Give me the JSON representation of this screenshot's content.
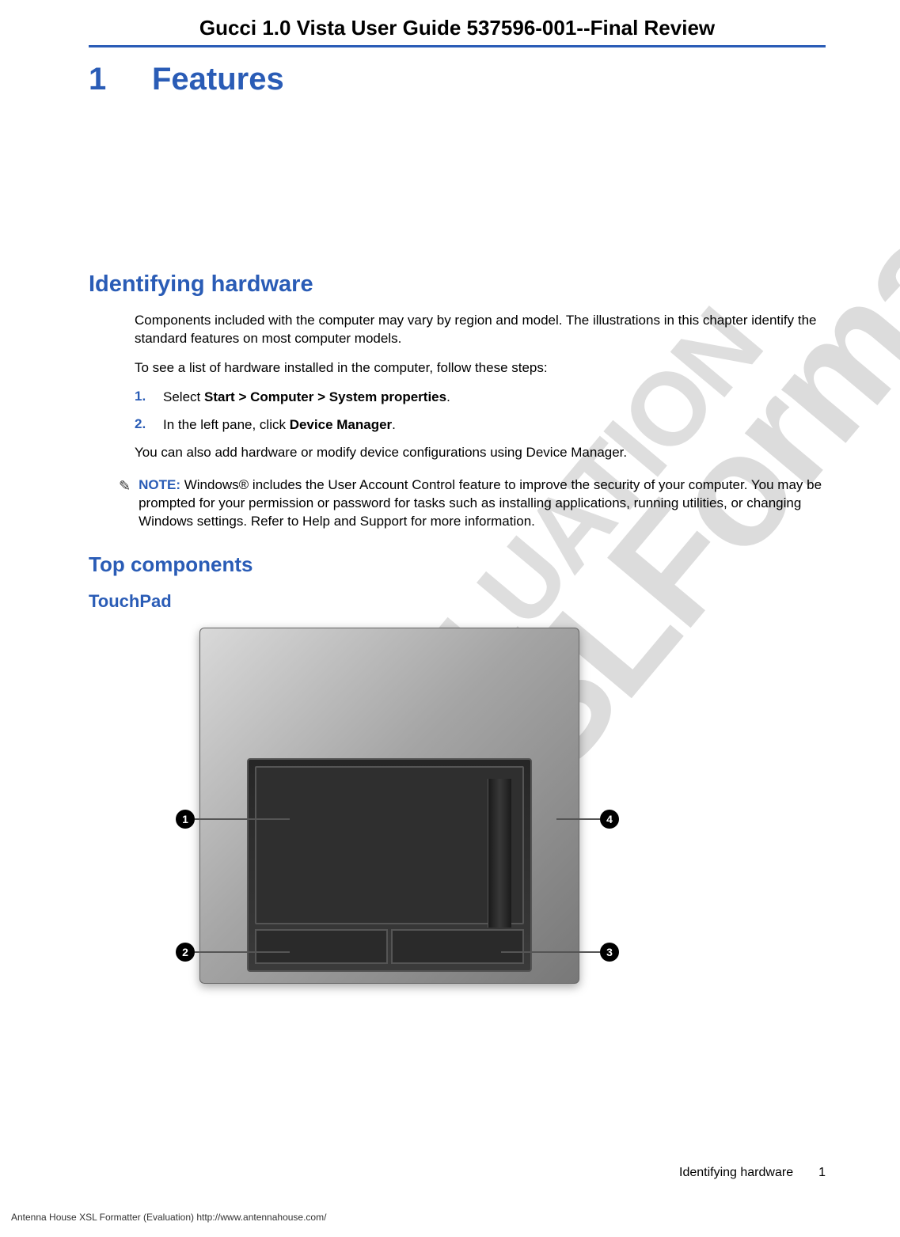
{
  "watermarks": {
    "main": "XSLFormatter",
    "sub": "EVALUATION"
  },
  "header": {
    "title": "Gucci 1.0 Vista User Guide 537596-001--Final Review"
  },
  "chapter": {
    "number": "1",
    "title": "Features"
  },
  "section1": {
    "title": "Identifying hardware",
    "para1": "Components included with the computer may vary by region and model. The illustrations in this chapter identify the standard features on most computer models.",
    "para2": "To see a list of hardware installed in the computer, follow these steps:",
    "steps": [
      {
        "num": "1.",
        "pre": "Select ",
        "bold": "Start > Computer > System properties",
        "post": "."
      },
      {
        "num": "2.",
        "pre": "In the left pane, click ",
        "bold": "Device Manager",
        "post": "."
      }
    ],
    "para3": "You can also add hardware or modify device configurations using Device Manager."
  },
  "note": {
    "label": "NOTE:",
    "text": "Windows® includes the User Account Control feature to improve the security of your computer. You may be prompted for your permission or password for tasks such as installing applications, running utilities, or changing Windows settings. Refer to Help and Support for more information."
  },
  "section2": {
    "title": "Top components"
  },
  "section3": {
    "title": "TouchPad"
  },
  "callouts": {
    "c1": "1",
    "c2": "2",
    "c3": "3",
    "c4": "4"
  },
  "footer": {
    "section": "Identifying hardware",
    "page": "1"
  },
  "vendor": "Antenna House XSL Formatter (Evaluation)  http://www.antennahouse.com/"
}
